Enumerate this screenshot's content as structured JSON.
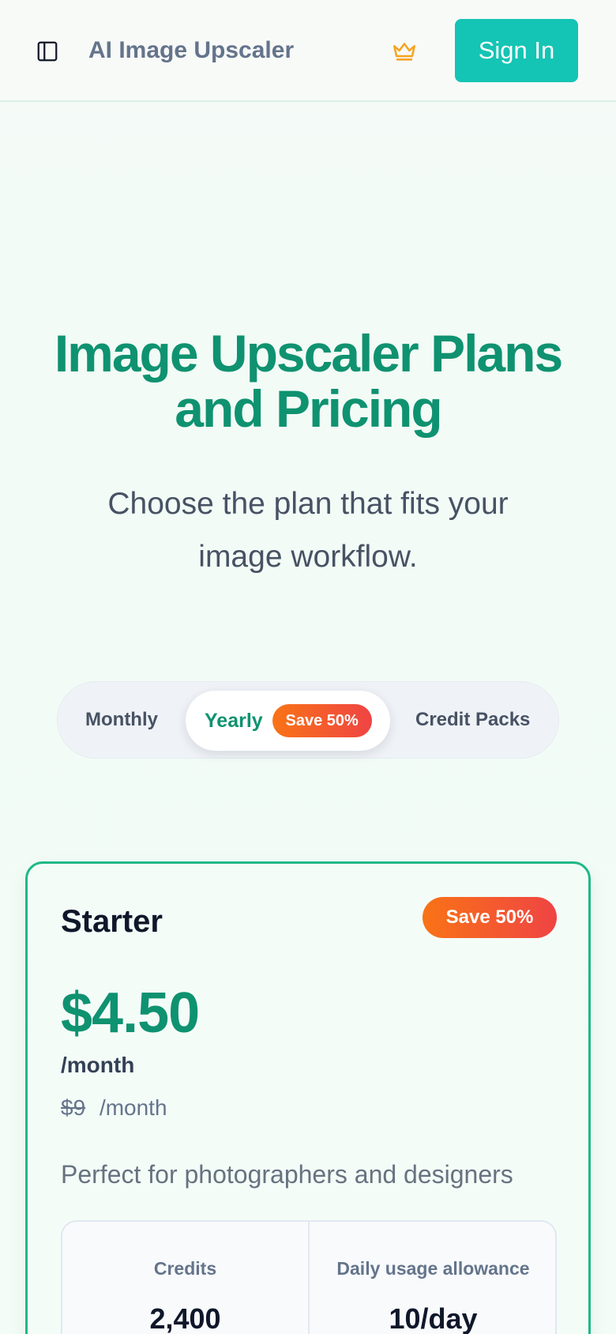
{
  "header": {
    "app_title": "AI Image Upscaler",
    "sign_in_label": "Sign In",
    "sidebar_icon": "sidebar-toggle-icon",
    "crown_icon": "crown-icon"
  },
  "hero": {
    "title": "Image Upscaler Plans and Pricing",
    "subtitle": "Choose the plan that fits your image workflow."
  },
  "billing": {
    "tabs": [
      {
        "label": "Monthly",
        "active": false
      },
      {
        "label": "Yearly",
        "active": true,
        "badge": "Save 50%"
      },
      {
        "label": "Credit Packs",
        "active": false
      }
    ]
  },
  "plan": {
    "name": "Starter",
    "badge": "Save 50%",
    "price": "$4.50",
    "period": "/month",
    "old_price": "$9",
    "old_period": "/month",
    "description": "Perfect for photographers and designers",
    "stats": [
      {
        "label": "Credits",
        "value": "2,400"
      },
      {
        "label": "Daily usage allowance",
        "value": "10/day"
      }
    ]
  },
  "colors": {
    "accent": "#14c4b4",
    "brand_green": "#0f9270",
    "card_border": "#1fb887",
    "badge_gradient_start": "#f97316",
    "badge_gradient_end": "#ef4444",
    "crown": "#f5a524"
  }
}
